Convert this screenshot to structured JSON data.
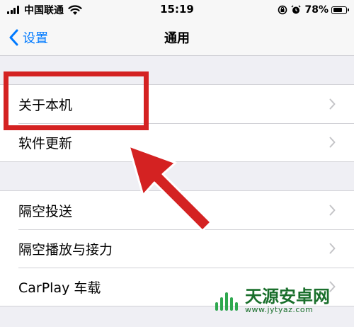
{
  "status_bar": {
    "carrier": "中国联通",
    "time": "15:19",
    "battery_percent": "78%",
    "battery_level": 0.78
  },
  "nav": {
    "back_label": "设置",
    "title": "通用"
  },
  "groups": [
    {
      "items": [
        {
          "label": "关于本机"
        },
        {
          "label": "软件更新"
        }
      ]
    },
    {
      "items": [
        {
          "label": "隔空投送"
        },
        {
          "label": "隔空播放与接力"
        },
        {
          "label": "CarPlay 车载"
        }
      ]
    }
  ],
  "annotation": {
    "highlight_color": "#d42222",
    "arrow_color": "#d42222"
  },
  "watermark": {
    "text": "天源安卓网",
    "url": "www.jytyaz.com"
  },
  "colors": {
    "accent": "#007aff",
    "background": "#efeff4",
    "separator": "#d1d1d6"
  }
}
